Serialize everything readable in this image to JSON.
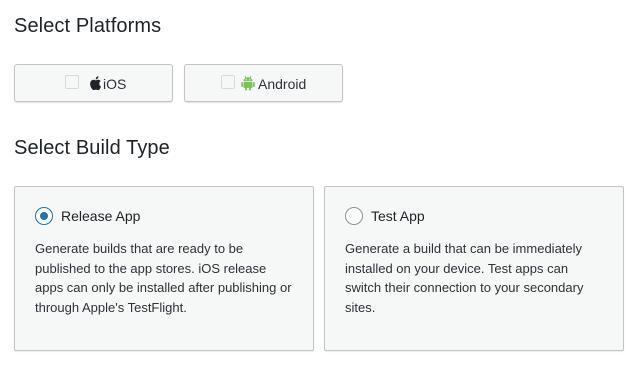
{
  "platforms": {
    "title": "Select Platforms",
    "options": [
      {
        "label": "iOS",
        "icon": "apple-icon",
        "checked": false
      },
      {
        "label": "Android",
        "icon": "android-icon",
        "checked": false,
        "icon_color": "#78c257"
      }
    ]
  },
  "build": {
    "title": "Select Build Type",
    "options": [
      {
        "label": "Release App",
        "selected": true,
        "description": "Generate builds that are ready to be published to the app stores. iOS release apps can only be installed after publishing or through Apple's TestFlight."
      },
      {
        "label": "Test App",
        "selected": false,
        "description": "Generate a build that can be immediately installed on your device. Test apps can switch their connection to your secondary sites."
      }
    ]
  },
  "colors": {
    "accent": "#2271b1",
    "android_green": "#78c257",
    "card_background": "#f6f7f7",
    "border": "#c3c4c7"
  }
}
